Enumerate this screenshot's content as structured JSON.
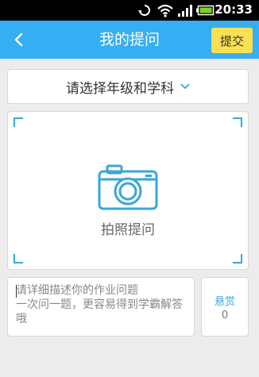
{
  "status_bar": {
    "time": "20:33"
  },
  "app_bar": {
    "title": "我的提问",
    "submit_label": "提交"
  },
  "subject_selector": {
    "label": "请选择年级和学科"
  },
  "photo_area": {
    "label": "拍照提问"
  },
  "description": {
    "placeholder": "请详细描述你的作业问题\n一次问一题，更容易得到学霸解答哦"
  },
  "reward": {
    "title": "悬赏",
    "value": "0"
  },
  "colors": {
    "accent": "#35aef3",
    "icon_blue": "#3aa6d8",
    "submit_bg": "#fbe052",
    "status_bar": "#000000",
    "battery": "#7ed321"
  },
  "icons": [
    "sync-icon",
    "wifi-icon",
    "signal-icon",
    "battery-icon",
    "back-arrow-icon",
    "chevron-down-icon",
    "camera-icon"
  ]
}
